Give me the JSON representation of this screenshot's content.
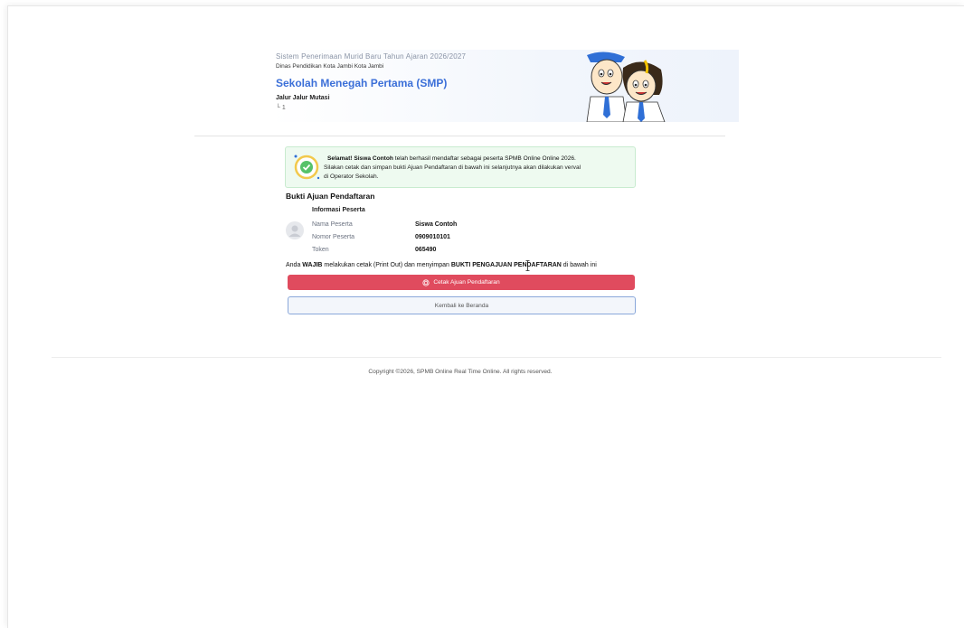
{
  "header": {
    "system": "Sistem Penerimaan Murid Baru  Tahun Ajaran 2026/2027",
    "dinas": "Dinas Pendidikan Kota Jambi Kota Jambi",
    "school": "Sekolah Menegah Pertama (SMP)",
    "jalur": "Jalur Jalur Mutasi",
    "sub": "└ 1"
  },
  "alert": {
    "prefix": "Selamat! ",
    "name": "Siswa Contoh",
    "line1_rest": " telah berhasil mendaftar sebagai peserta SPMB Online Online 2026.",
    "line2": "Silakan cetak dan simpan bukti Ajuan Pendaftaran di bawah ini selanjutnya akan dilakukan verval",
    "line3": "di Operator Sekolah."
  },
  "section_title": "Bukti Ajuan Pendaftaran",
  "info": {
    "title": "Informasi Peserta",
    "rows": [
      {
        "label": "Nama Peserta",
        "value": "Siswa Contoh"
      },
      {
        "label": "Nomor Peserta",
        "value": "0909010101"
      },
      {
        "label": "Token",
        "value": "065490"
      }
    ]
  },
  "notice": {
    "a": "Anda ",
    "b": "WAJIB",
    "c": " melakukan cetak (Print Out) dan menyimpan ",
    "d": "BUKTI PENGAJUAN PENDAFTARAN",
    "e": " di bawah ini"
  },
  "buttons": {
    "print": "Cetak Ajuan Pendaftaran",
    "back": "Kembali ke Beranda"
  },
  "footer": "Copyright ©2026, SPMB Online Real Time Online. All rights reserved.",
  "colors": {
    "accent": "#3b6fd8",
    "print_button": "#e04b5e",
    "success_bg": "#eefaf0"
  }
}
